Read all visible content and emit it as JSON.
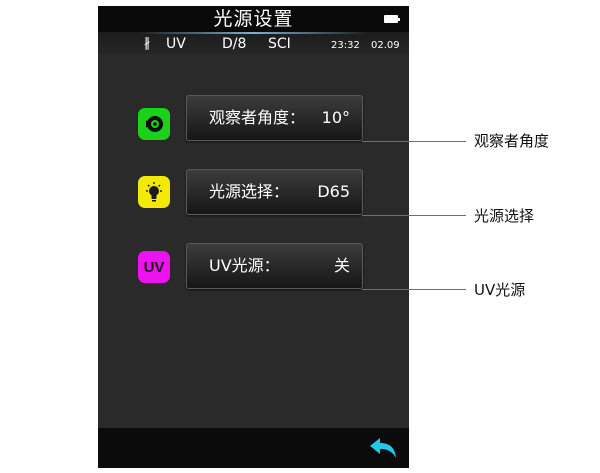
{
  "header": {
    "title": "光源设置"
  },
  "status": {
    "bluetooth_glyph": "∦",
    "mode": "UV",
    "geometry": "D/8",
    "spec": "SCI",
    "time": "23:32",
    "date": "02.09"
  },
  "settings": [
    {
      "label": "观察者角度：",
      "value": "10°",
      "icon": "observer-eye-icon",
      "icon_color": "#19d219"
    },
    {
      "label": "光源选择：",
      "value": "D65",
      "icon": "lightbulb-icon",
      "icon_color": "#f2ea05",
      "icon_ring": "#f5d20a"
    },
    {
      "label": "UV光源：",
      "value": "关",
      "icon_text": "UV",
      "icon_color": "#ee12ee"
    }
  ],
  "callouts": [
    "观察者角度",
    "光源选择",
    "UV光源"
  ],
  "colors": {
    "back_arrow": "#22c8e8",
    "screen_bg": "#2a2a2a"
  }
}
